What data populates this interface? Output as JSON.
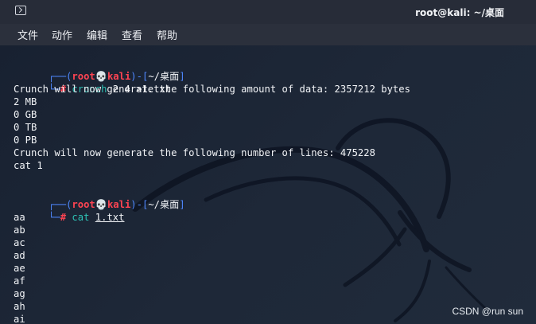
{
  "window": {
    "title": "root@kali: ~/桌面"
  },
  "menu": {
    "file": "文件",
    "action": "动作",
    "edit": "编辑",
    "view": "查看",
    "help": "帮助"
  },
  "prompt": {
    "start": "┌──(",
    "user": "root",
    "skull": "💀",
    "host": "kali",
    "middle": ")-[",
    "path": "~/桌面",
    "end": "]",
    "bottom": "└─",
    "hash": "#"
  },
  "commands": {
    "first_command": "crunch",
    "first_args": " 2 4 ",
    "first_redirect": ">1.txt",
    "second_command": "cat",
    "second_file": "1.txt"
  },
  "output": {
    "lines": [
      "Crunch will now generate the following amount of data: 2357212 bytes",
      "2 MB",
      "0 GB",
      "0 TB",
      "0 PB",
      "Crunch will now generate the following number of lines: 475228",
      "cat 1"
    ],
    "cat_lines": [
      "aa",
      "ab",
      "ac",
      "ad",
      "ae",
      "af",
      "ag",
      "ah",
      "ai"
    ]
  },
  "watermark": "CSDN @run sun"
}
